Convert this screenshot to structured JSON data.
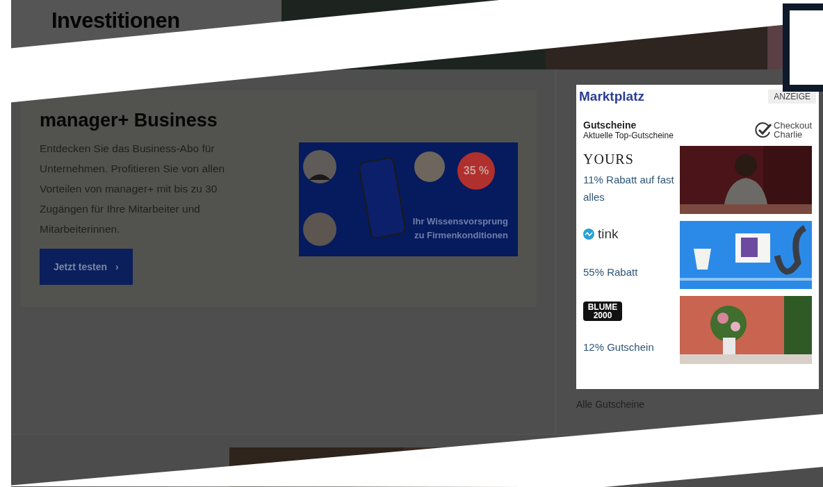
{
  "top_teaser": {
    "heading": "Investitionen"
  },
  "business_promo": {
    "title": "manager+ Business",
    "text": "Entdecken Sie das Business-Abo für Unternehmen. Profitieren Sie von allen Vorteilen von manager+ mit bis zu 30 Zugängen für Ihre Mitarbeiter und Mitarbeiterinnen.",
    "button": "Jetzt testen",
    "chevron": "›",
    "banner": {
      "badge": "35 %",
      "tagline": [
        "Ihr Wissensvorsprung",
        "zu Firmenkonditionen"
      ]
    }
  },
  "marketplace": {
    "title": "Marktplatz",
    "ad_label": "ANZEIGE",
    "section_title": "Gutscheine",
    "section_subtitle": "Aktuelle Top-Gutscheine",
    "partner": [
      "Checkout",
      "Charlie"
    ],
    "offers": [
      {
        "kind": "serif",
        "logo": "YOURS",
        "offer": "11% Rabatt auf fast alles"
      },
      {
        "kind": "dot",
        "logo": "tink",
        "offer": "55% Rabatt"
      },
      {
        "kind": "block",
        "logo": "BLUME 2000",
        "offer": "12% Gutschein"
      }
    ],
    "link": "Alle Gutscheine"
  }
}
